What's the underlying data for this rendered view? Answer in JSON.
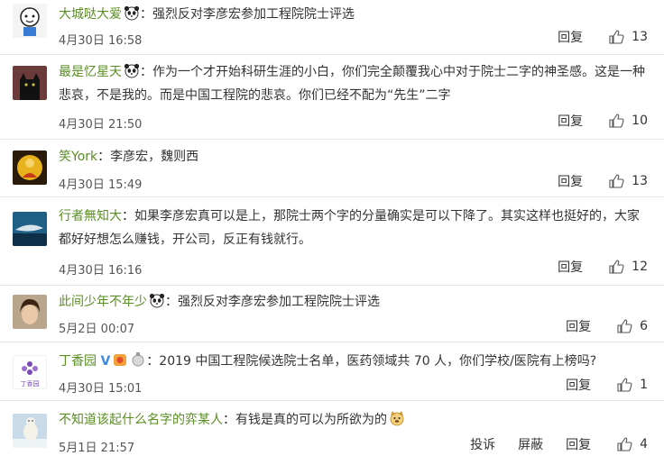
{
  "comments": [
    {
      "name": "大城哒大爱",
      "sep": "：",
      "text": "强烈反对李彦宏参加工程院院士评选",
      "emoji": "panda-face",
      "time": "4月30日 16:58",
      "reply_label": "回复",
      "likes": "13",
      "avatar": "cartoon-avatar"
    },
    {
      "name": "最是忆星天",
      "sep": "：",
      "text": "作为一个才开始科研生涯的小白，你们完全颠覆我心中对于院士二字的神圣感。这是一种悲哀，不是我的。而是中国工程院的悲哀。你们已经不配为“先生”二字",
      "emoji": "panda-face",
      "time": "4月30日 21:50",
      "reply_label": "回复",
      "likes": "10",
      "avatar": "black-cat-avatar"
    },
    {
      "name": "笑York",
      "sep": "：",
      "text": "李彦宏，魏则西",
      "time": "4月30日 15:49",
      "reply_label": "回复",
      "likes": "13",
      "avatar": "yellow-figure-avatar"
    },
    {
      "name": "行者無知大",
      "sep": "：",
      "text": "如果李彦宏真可以是上，那院士两个字的分量确实是可以下降了。其实这样也挺好的，大家都好好想怎么赚钱，开公司，反正有钱就行。",
      "time": "4月30日 16:16",
      "reply_label": "回复",
      "likes": "12",
      "avatar": "shark-avatar"
    },
    {
      "name": "此间少年不年少",
      "sep": "：",
      "text": "强烈反对李彦宏参加工程院院士评选",
      "emoji": "panda-face",
      "time": "5月2日 00:07",
      "reply_label": "回复",
      "likes": "6",
      "avatar": "portrait-avatar"
    },
    {
      "name": "丁香园",
      "badge": "V",
      "sep": "：",
      "text": "2019 中国工程院候选院士名单，医药领域共 70 人，你们学校/医院有上榜吗?",
      "time": "4月30日 15:01",
      "reply_label": "回复",
      "likes": "1",
      "avatar": "dxy-logo-avatar",
      "avatar_text": "丁香园"
    },
    {
      "name": "不知道该起什么名字的弈某人",
      "sep": "：",
      "text": "有钱是真的可以为所欲为的",
      "emoji": "dog-face",
      "time": "5月1日 21:57",
      "report_label": "投诉",
      "block_label": "屏蔽",
      "reply_label": "回复",
      "likes": "4",
      "avatar": "polar-bear-avatar"
    }
  ],
  "colors": {
    "name": "#5a8e23",
    "divider": "#e6e6e6",
    "text": "#333333",
    "meta": "#555555"
  }
}
